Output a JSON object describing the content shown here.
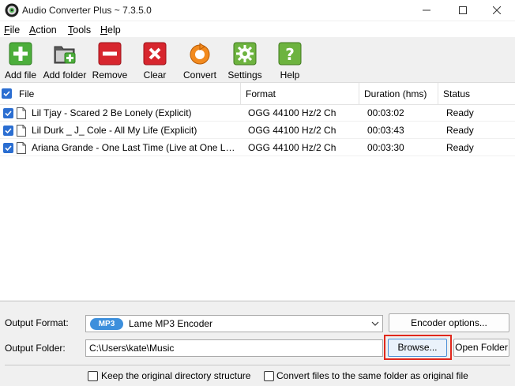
{
  "window": {
    "title": "Audio Converter Plus ~ 7.3.5.0"
  },
  "menu": [
    {
      "label": "File",
      "underline": "F",
      "rest": "ile"
    },
    {
      "label": "Action",
      "underline": "A",
      "rest": "ction"
    },
    {
      "label": "Tools",
      "underline": "T",
      "rest": "ools"
    },
    {
      "label": "Help",
      "underline": "H",
      "rest": "elp"
    }
  ],
  "toolbar": {
    "add_file": "Add file",
    "add_folder": "Add folder",
    "remove": "Remove",
    "clear": "Clear",
    "convert": "Convert",
    "settings": "Settings",
    "help": "Help"
  },
  "table": {
    "columns": [
      "File",
      "Format",
      "Duration (hms)",
      "Status"
    ],
    "rows": [
      {
        "file": "Lil Tjay - Scared 2 Be Lonely (Explicit)",
        "format": "OGG 44100 Hz/2 Ch",
        "duration": "00:03:02",
        "status": "Ready",
        "checked": true
      },
      {
        "file": "Lil Durk _ J_ Cole - All My Life (Explicit)",
        "format": "OGG 44100 Hz/2 Ch",
        "duration": "00:03:43",
        "status": "Ready",
        "checked": true
      },
      {
        "file": "Ariana Grande - One Last Time (Live at One Love M...",
        "format": "OGG 44100 Hz/2 Ch",
        "duration": "00:03:30",
        "status": "Ready",
        "checked": true
      }
    ]
  },
  "output": {
    "format_label": "Output Format:",
    "format_badge": "MP3",
    "format_value": "Lame MP3 Encoder",
    "encoder_options": "Encoder options...",
    "folder_label": "Output Folder:",
    "folder_value": "C:\\Users\\kate\\Music",
    "browse": "Browse...",
    "open_folder": "Open Folder",
    "keep_structure": "Keep the original directory structure",
    "same_folder": "Convert files to the same folder as original file"
  },
  "colors": {
    "accent": "#2b6ed1",
    "highlight": "#e0281c",
    "badge": "#3d8fdc"
  }
}
